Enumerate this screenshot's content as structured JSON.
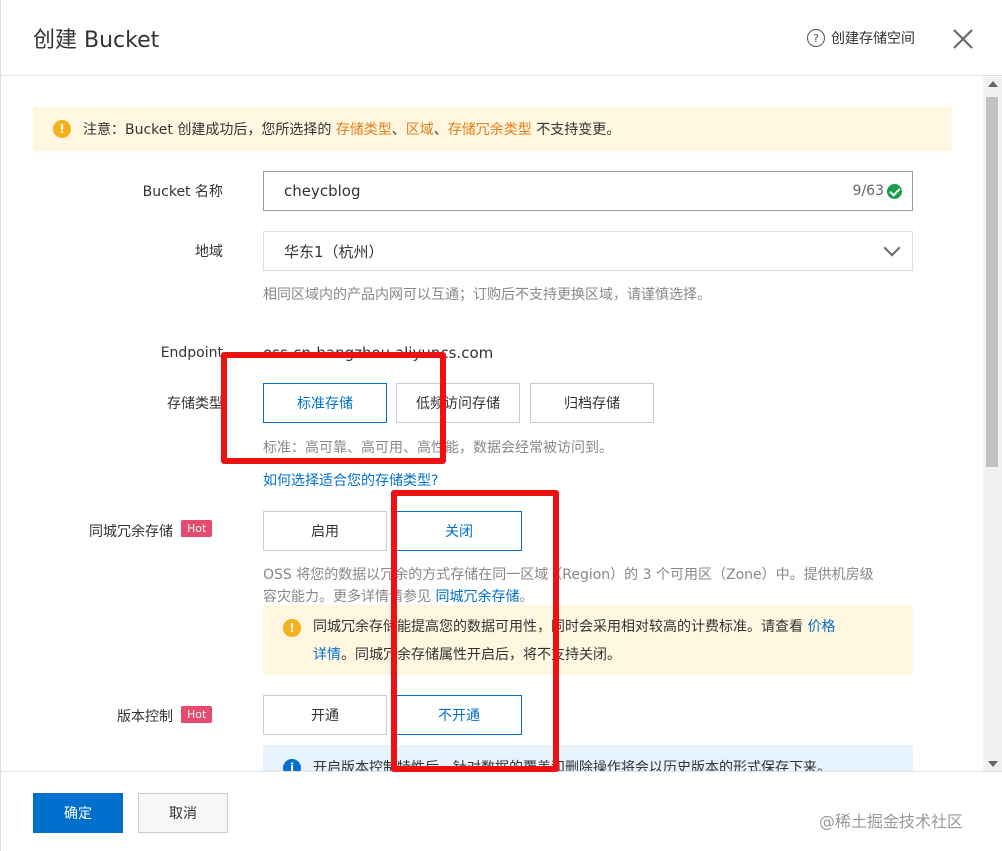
{
  "dialog": {
    "title": "创建 Bucket",
    "help_label": "创建存储空间",
    "help_icon_glyph": "?"
  },
  "notice": {
    "prefix": "注意：Bucket 创建成功后，您所选择的 ",
    "item1": "存储类型",
    "sep1": "、",
    "item2": "区域",
    "sep2": "、",
    "item3": "存储冗余类型",
    "suffix": " 不支持变更。",
    "icon_glyph": "!"
  },
  "bucket_name": {
    "label": "Bucket 名称",
    "value": "cheycblog",
    "counter": "9/63"
  },
  "region": {
    "label": "地域",
    "value": "华东1（杭州）",
    "hint": "相同区域内的产品内网可以互通；订购后不支持更换区域，请谨慎选择。"
  },
  "endpoint": {
    "label": "Endpoint",
    "value": "oss-cn-hangzhou.aliyuncs.com"
  },
  "storage_class": {
    "label": "存储类型",
    "options": [
      "标准存储",
      "低频访问存储",
      "归档存储"
    ],
    "selected_index": 0,
    "hint": "标准：高可靠、高可用、高性能，数据会经常被访问到。",
    "help_link": "如何选择适合您的存储类型?"
  },
  "zrs": {
    "label": "同城冗余存储",
    "badge": "Hot",
    "options": [
      "启用",
      "关闭"
    ],
    "selected_index": 1,
    "hint_line1": "OSS 将您的数据以冗余的方式存储在同一区域（Region）的 3 个可用区（Zone）中。提供机房级",
    "hint_line2_prefix": "容灾能力。更多详情请参见 ",
    "hint_link": "同城冗余存储",
    "hint_line2_suffix": "。",
    "warn_line1_prefix": "同城冗余存储能提高您的数据可用性，同时会采用相对较高的计费标准。请查看 ",
    "warn_link1": "价格",
    "warn_link2": "详情",
    "warn_line2_suffix": "。同城冗余存储属性开启后，将不支持关闭。",
    "warn_icon_glyph": "!"
  },
  "versioning": {
    "label": "版本控制",
    "badge": "Hot",
    "options": [
      "开通",
      "不开通"
    ],
    "selected_index": 1,
    "info": "开启版本控制特性后，针对数据的覆盖和删除操作将会以历史版本的形式保存下来。",
    "info_icon_glyph": "i"
  },
  "footer": {
    "confirm_label": "确定",
    "cancel_label": "取消",
    "watermark": "@稀土掘金技术社区"
  },
  "colors": {
    "primary": "#0070cc",
    "warning_bg": "#fff7e0",
    "hot_badge": "#e74a6f",
    "annotation_red": "#ee1111"
  }
}
